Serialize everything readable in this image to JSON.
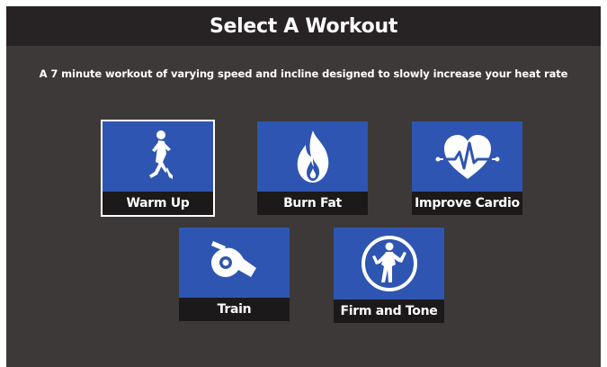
{
  "header": {
    "title": "Select A Workout"
  },
  "description": "A 7 minute workout of varying speed and incline designed to slowly increase your heat rate",
  "colors": {
    "tile_blue": "#2e55b1",
    "label_bar": "#1c191a",
    "background": "#3d3938",
    "title_bar": "#272223",
    "selected_outline": "#ffffff"
  },
  "workouts": [
    {
      "label": "Warm Up",
      "icon": "runner-icon",
      "selected": true
    },
    {
      "label": "Burn Fat",
      "icon": "flame-icon",
      "selected": false
    },
    {
      "label": "Improve Cardio",
      "icon": "heart-pulse-icon",
      "selected": false
    },
    {
      "label": "Train",
      "icon": "whistle-icon",
      "selected": false
    },
    {
      "label": "Firm and Tone",
      "icon": "fitness-woman-icon",
      "selected": false
    }
  ]
}
